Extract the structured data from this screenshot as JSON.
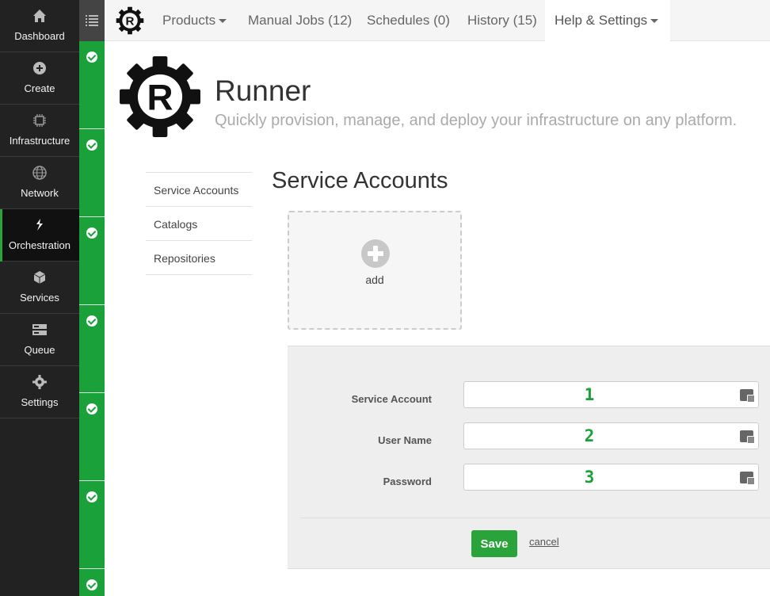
{
  "sidebar": {
    "items": [
      {
        "label": "Dashboard",
        "icon": "home-icon"
      },
      {
        "label": "Create",
        "icon": "plus-circle-icon"
      },
      {
        "label": "Infrastructure",
        "icon": "chip-icon"
      },
      {
        "label": "Network",
        "icon": "globe-icon"
      },
      {
        "label": "Orchestration",
        "icon": "orchestration-icon",
        "active": true
      },
      {
        "label": "Services",
        "icon": "cube-icon"
      },
      {
        "label": "Queue",
        "icon": "queue-icon"
      },
      {
        "label": "Settings",
        "icon": "gear-icon"
      }
    ]
  },
  "topnav": {
    "items": [
      {
        "label": "Products",
        "dropdown": true
      },
      {
        "label": "Manual Jobs (12)"
      },
      {
        "label": "Schedules (0)"
      },
      {
        "label": "History (15)"
      },
      {
        "label": "Help & Settings",
        "dropdown": true,
        "active": true
      }
    ]
  },
  "header": {
    "logo_letter": "R",
    "title": "Runner",
    "subtitle": "Quickly provision, manage, and deploy your infrastructure on any platform."
  },
  "subnav": {
    "items": [
      {
        "label": "Service Accounts"
      },
      {
        "label": "Catalogs"
      },
      {
        "label": "Repositories"
      }
    ]
  },
  "main": {
    "title": "Service Accounts",
    "add_label": "add"
  },
  "form": {
    "fields": [
      {
        "label": "Service Account",
        "value": "1"
      },
      {
        "label": "User Name",
        "value": "2"
      },
      {
        "label": "Password",
        "value": "3"
      }
    ],
    "save_label": "Save",
    "cancel_label": "cancel"
  },
  "colors": {
    "accent_green": "#1aa13a",
    "sidebar_bg": "#222222"
  }
}
